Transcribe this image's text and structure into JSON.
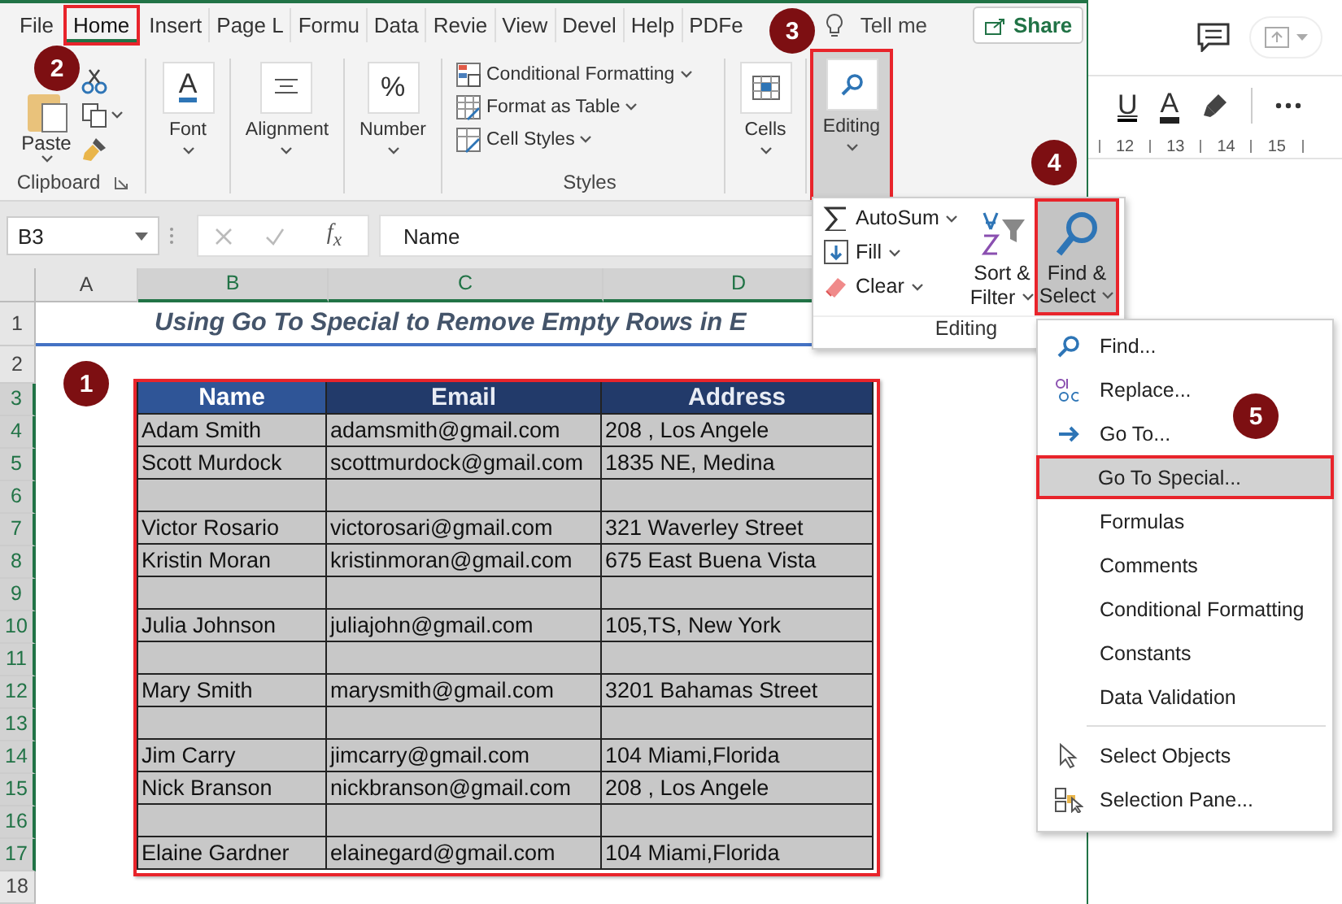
{
  "excel": {
    "tabs": [
      {
        "label": "File",
        "selected": false
      },
      {
        "label": "Home",
        "selected": true
      },
      {
        "label": "Insert",
        "selected": false
      },
      {
        "label": "Page L",
        "selected": false
      },
      {
        "label": "Formu",
        "selected": false
      },
      {
        "label": "Data",
        "selected": false
      },
      {
        "label": "Revie",
        "selected": false
      },
      {
        "label": "View",
        "selected": false
      },
      {
        "label": "Devel",
        "selected": false
      },
      {
        "label": "Help",
        "selected": false
      },
      {
        "label": "PDFe",
        "selected": false
      }
    ],
    "tell_me": "Tell me",
    "share": "Share",
    "ribbon": {
      "clipboard": {
        "paste": "Paste",
        "label": "Clipboard"
      },
      "groups": [
        {
          "kind": "font",
          "label": "Font",
          "glyph": "A"
        },
        {
          "kind": "alignment",
          "label": "Alignment"
        },
        {
          "kind": "number",
          "label": "Number",
          "glyph": "%"
        }
      ],
      "styles": {
        "items": [
          {
            "kind": "conditional",
            "label": "Conditional Formatting"
          },
          {
            "kind": "table",
            "label": "Format as Table"
          },
          {
            "kind": "cellstyles",
            "label": "Cell Styles"
          }
        ],
        "label": "Styles"
      },
      "cells": {
        "label": "Cells"
      },
      "editing": {
        "label": "Editing",
        "selected": true
      }
    },
    "formula_bar": {
      "name_box": "B3",
      "function_label": "f$_{x}$",
      "formula": "Name"
    },
    "sheet": {
      "columns": [
        {
          "label": "A",
          "selected": false
        },
        {
          "label": "B",
          "selected": true
        },
        {
          "label": "C",
          "selected": true
        },
        {
          "label": "D",
          "selected": true
        }
      ],
      "rows": [
        {
          "label": "1",
          "selected": false
        },
        {
          "label": "2",
          "selected": false
        },
        {
          "label": "3",
          "selected": true
        },
        {
          "label": "4",
          "selected": true
        },
        {
          "label": "5",
          "selected": true
        },
        {
          "label": "6",
          "selected": true
        },
        {
          "label": "7",
          "selected": true
        },
        {
          "label": "8",
          "selected": true
        },
        {
          "label": "9",
          "selected": true
        },
        {
          "label": "10",
          "selected": true
        },
        {
          "label": "11",
          "selected": true
        },
        {
          "label": "12",
          "selected": true
        },
        {
          "label": "13",
          "selected": true
        },
        {
          "label": "14",
          "selected": true
        },
        {
          "label": "15",
          "selected": true
        },
        {
          "label": "16",
          "selected": true
        },
        {
          "label": "17",
          "selected": true
        },
        {
          "label": "18",
          "selected": false
        }
      ],
      "title": "Using Go To Special to Remove Empty Rows in E",
      "table": {
        "columns": [
          "Name",
          "Email",
          "Address"
        ],
        "rows": [
          {
            "kind": "data",
            "cells": [
              "Adam Smith",
              "adamsmith@gmail.com",
              "208 , Los Angele"
            ]
          },
          {
            "kind": "data",
            "cells": [
              "Scott Murdock",
              "scottmurdock@gmail.com",
              "1835  NE, Medina"
            ]
          },
          {
            "kind": "blank"
          },
          {
            "kind": "data",
            "cells": [
              "Victor Rosario",
              "victorosari@gmail.com",
              "321 Waverley Street"
            ]
          },
          {
            "kind": "data",
            "cells": [
              "Kristin Moran",
              "kristinmoran@gmail.com",
              "675 East Buena Vista"
            ]
          },
          {
            "kind": "blank"
          },
          {
            "kind": "data",
            "cells": [
              "Julia Johnson",
              "juliajohn@gmail.com",
              "105,TS, New York"
            ]
          },
          {
            "kind": "blank"
          },
          {
            "kind": "data",
            "cells": [
              "Mary Smith",
              "marysmith@gmail.com",
              "3201 Bahamas Street"
            ]
          },
          {
            "kind": "blank"
          },
          {
            "kind": "data",
            "cells": [
              "Jim Carry",
              "jimcarry@gmail.com",
              "104 Miami,Florida"
            ]
          },
          {
            "kind": "data",
            "cells": [
              "Nick Branson",
              "nickbranson@gmail.com",
              "208 , Los Angele"
            ]
          },
          {
            "kind": "blank"
          },
          {
            "kind": "data",
            "cells": [
              "Elaine Gardner",
              "elainegard@gmail.com",
              "104 Miami,Florida"
            ]
          }
        ]
      }
    }
  },
  "editing_panel": {
    "items": [
      {
        "kind": "autosum",
        "label": "AutoSum"
      },
      {
        "kind": "fill",
        "label": "Fill"
      },
      {
        "kind": "clear",
        "label": "Clear"
      }
    ],
    "sort_filter": "Sort & Filter",
    "find_select": {
      "label": "Find & Select",
      "selected": true
    },
    "label": "Editing"
  },
  "find_menu": {
    "items": [
      {
        "kind": "find",
        "label": "Find...",
        "selected": false
      },
      {
        "kind": "replace",
        "label": "Replace...",
        "selected": false
      },
      {
        "kind": "goto",
        "label": "Go To...",
        "selected": false
      },
      {
        "kind": "plain",
        "label": "Go To Special...",
        "selected": true
      },
      {
        "kind": "plain",
        "label": "Formulas",
        "selected": false
      },
      {
        "kind": "plain",
        "label": "Comments",
        "selected": false
      },
      {
        "kind": "plain",
        "label": "Conditional Formatting",
        "selected": false
      },
      {
        "kind": "plain",
        "label": "Constants",
        "selected": false
      },
      {
        "kind": "plain",
        "label": "Data Validation",
        "selected": false
      },
      {
        "kind": "separator"
      },
      {
        "kind": "objects",
        "label": "Select Objects",
        "selected": false
      },
      {
        "kind": "pane",
        "label": "Selection Pane...",
        "selected": false
      }
    ]
  },
  "document_app": {
    "format_letters": [
      {
        "kind": "underline",
        "label": "U"
      },
      {
        "kind": "font_color",
        "label": "A"
      }
    ],
    "ruler": [
      "12",
      "13",
      "14",
      "15"
    ]
  },
  "steps": [
    "1",
    "2",
    "3",
    "4",
    "5"
  ]
}
